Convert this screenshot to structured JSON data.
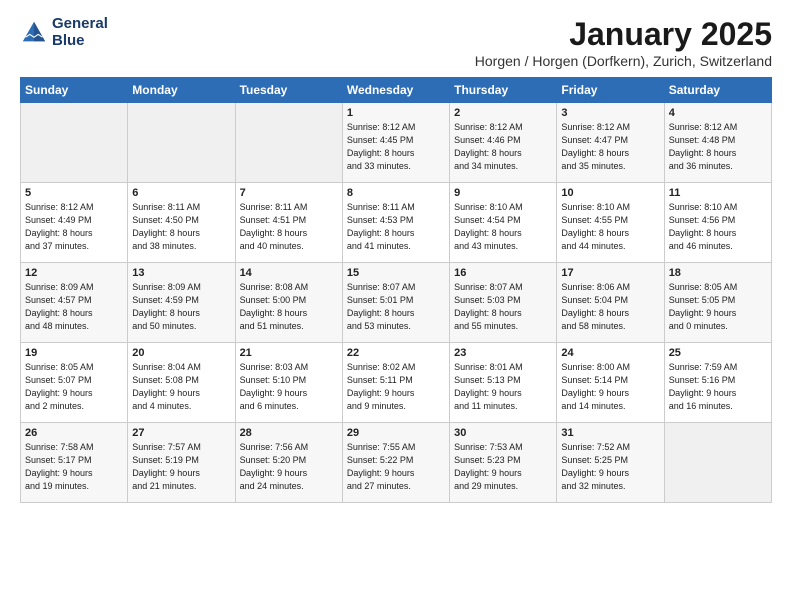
{
  "logo": {
    "line1": "General",
    "line2": "Blue"
  },
  "title": "January 2025",
  "location": "Horgen / Horgen (Dorfkern), Zurich, Switzerland",
  "days_header": [
    "Sunday",
    "Monday",
    "Tuesday",
    "Wednesday",
    "Thursday",
    "Friday",
    "Saturday"
  ],
  "weeks": [
    [
      {
        "day": "",
        "info": ""
      },
      {
        "day": "",
        "info": ""
      },
      {
        "day": "",
        "info": ""
      },
      {
        "day": "1",
        "info": "Sunrise: 8:12 AM\nSunset: 4:45 PM\nDaylight: 8 hours\nand 33 minutes."
      },
      {
        "day": "2",
        "info": "Sunrise: 8:12 AM\nSunset: 4:46 PM\nDaylight: 8 hours\nand 34 minutes."
      },
      {
        "day": "3",
        "info": "Sunrise: 8:12 AM\nSunset: 4:47 PM\nDaylight: 8 hours\nand 35 minutes."
      },
      {
        "day": "4",
        "info": "Sunrise: 8:12 AM\nSunset: 4:48 PM\nDaylight: 8 hours\nand 36 minutes."
      }
    ],
    [
      {
        "day": "5",
        "info": "Sunrise: 8:12 AM\nSunset: 4:49 PM\nDaylight: 8 hours\nand 37 minutes."
      },
      {
        "day": "6",
        "info": "Sunrise: 8:11 AM\nSunset: 4:50 PM\nDaylight: 8 hours\nand 38 minutes."
      },
      {
        "day": "7",
        "info": "Sunrise: 8:11 AM\nSunset: 4:51 PM\nDaylight: 8 hours\nand 40 minutes."
      },
      {
        "day": "8",
        "info": "Sunrise: 8:11 AM\nSunset: 4:53 PM\nDaylight: 8 hours\nand 41 minutes."
      },
      {
        "day": "9",
        "info": "Sunrise: 8:10 AM\nSunset: 4:54 PM\nDaylight: 8 hours\nand 43 minutes."
      },
      {
        "day": "10",
        "info": "Sunrise: 8:10 AM\nSunset: 4:55 PM\nDaylight: 8 hours\nand 44 minutes."
      },
      {
        "day": "11",
        "info": "Sunrise: 8:10 AM\nSunset: 4:56 PM\nDaylight: 8 hours\nand 46 minutes."
      }
    ],
    [
      {
        "day": "12",
        "info": "Sunrise: 8:09 AM\nSunset: 4:57 PM\nDaylight: 8 hours\nand 48 minutes."
      },
      {
        "day": "13",
        "info": "Sunrise: 8:09 AM\nSunset: 4:59 PM\nDaylight: 8 hours\nand 50 minutes."
      },
      {
        "day": "14",
        "info": "Sunrise: 8:08 AM\nSunset: 5:00 PM\nDaylight: 8 hours\nand 51 minutes."
      },
      {
        "day": "15",
        "info": "Sunrise: 8:07 AM\nSunset: 5:01 PM\nDaylight: 8 hours\nand 53 minutes."
      },
      {
        "day": "16",
        "info": "Sunrise: 8:07 AM\nSunset: 5:03 PM\nDaylight: 8 hours\nand 55 minutes."
      },
      {
        "day": "17",
        "info": "Sunrise: 8:06 AM\nSunset: 5:04 PM\nDaylight: 8 hours\nand 58 minutes."
      },
      {
        "day": "18",
        "info": "Sunrise: 8:05 AM\nSunset: 5:05 PM\nDaylight: 9 hours\nand 0 minutes."
      }
    ],
    [
      {
        "day": "19",
        "info": "Sunrise: 8:05 AM\nSunset: 5:07 PM\nDaylight: 9 hours\nand 2 minutes."
      },
      {
        "day": "20",
        "info": "Sunrise: 8:04 AM\nSunset: 5:08 PM\nDaylight: 9 hours\nand 4 minutes."
      },
      {
        "day": "21",
        "info": "Sunrise: 8:03 AM\nSunset: 5:10 PM\nDaylight: 9 hours\nand 6 minutes."
      },
      {
        "day": "22",
        "info": "Sunrise: 8:02 AM\nSunset: 5:11 PM\nDaylight: 9 hours\nand 9 minutes."
      },
      {
        "day": "23",
        "info": "Sunrise: 8:01 AM\nSunset: 5:13 PM\nDaylight: 9 hours\nand 11 minutes."
      },
      {
        "day": "24",
        "info": "Sunrise: 8:00 AM\nSunset: 5:14 PM\nDaylight: 9 hours\nand 14 minutes."
      },
      {
        "day": "25",
        "info": "Sunrise: 7:59 AM\nSunset: 5:16 PM\nDaylight: 9 hours\nand 16 minutes."
      }
    ],
    [
      {
        "day": "26",
        "info": "Sunrise: 7:58 AM\nSunset: 5:17 PM\nDaylight: 9 hours\nand 19 minutes."
      },
      {
        "day": "27",
        "info": "Sunrise: 7:57 AM\nSunset: 5:19 PM\nDaylight: 9 hours\nand 21 minutes."
      },
      {
        "day": "28",
        "info": "Sunrise: 7:56 AM\nSunset: 5:20 PM\nDaylight: 9 hours\nand 24 minutes."
      },
      {
        "day": "29",
        "info": "Sunrise: 7:55 AM\nSunset: 5:22 PM\nDaylight: 9 hours\nand 27 minutes."
      },
      {
        "day": "30",
        "info": "Sunrise: 7:53 AM\nSunset: 5:23 PM\nDaylight: 9 hours\nand 29 minutes."
      },
      {
        "day": "31",
        "info": "Sunrise: 7:52 AM\nSunset: 5:25 PM\nDaylight: 9 hours\nand 32 minutes."
      },
      {
        "day": "",
        "info": ""
      }
    ]
  ]
}
